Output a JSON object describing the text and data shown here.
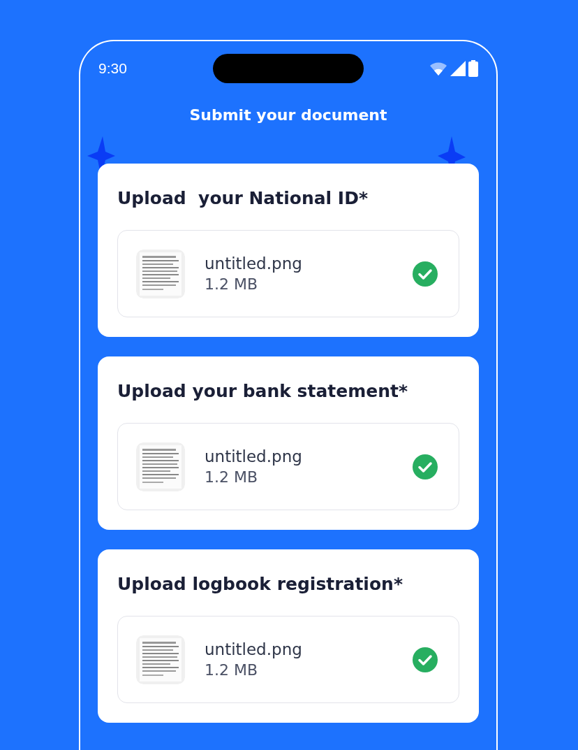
{
  "status_bar": {
    "time": "9:30"
  },
  "title": "Submit your document",
  "uploads": [
    {
      "heading": "Upload  your National ID*",
      "file": {
        "name": "untitled.png",
        "size": "1.2 MB",
        "uploaded": true
      }
    },
    {
      "heading": "Upload your bank statement*",
      "file": {
        "name": "untitled.png",
        "size": "1.2 MB",
        "uploaded": true
      }
    },
    {
      "heading": "Upload logbook registration*",
      "file": {
        "name": "untitled.png",
        "size": "1.2 MB",
        "uploaded": true
      }
    }
  ]
}
